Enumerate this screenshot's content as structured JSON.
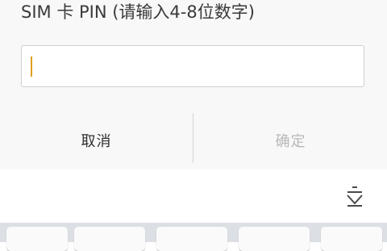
{
  "dialog": {
    "title": "SIM 卡 PIN (请输入4-8位数字)",
    "pin_value": "",
    "cancel_label": "取消",
    "ok_label": "确定"
  },
  "keyboard": {
    "collapse_icon": "collapse-keyboard-icon",
    "visible_keys": 5
  },
  "colors": {
    "caret": "#e0a01c",
    "ok_disabled": "#b8b8b8",
    "dialog_bg": "#f8f8f8",
    "keyboard_bg": "#dcdfe3"
  }
}
